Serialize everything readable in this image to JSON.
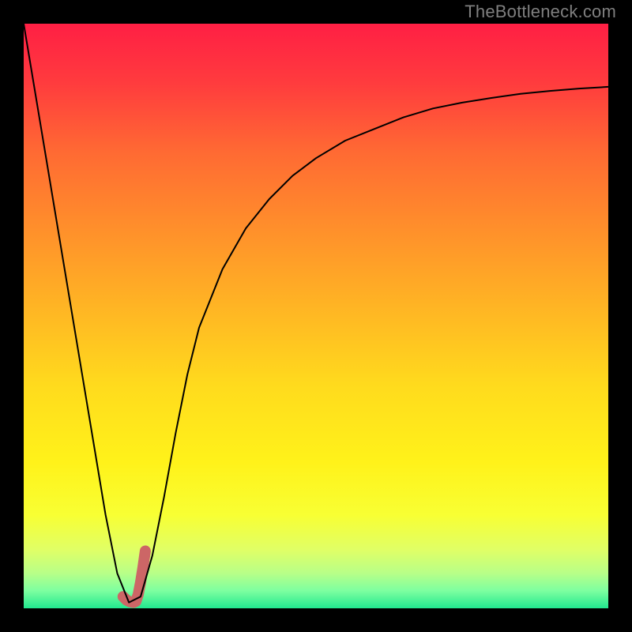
{
  "watermark": "TheBottleneck.com",
  "chart_data": {
    "type": "line",
    "title": "",
    "xlabel": "",
    "ylabel": "",
    "xlim": [
      0,
      100
    ],
    "ylim": [
      0,
      100
    ],
    "grid": false,
    "series": [
      {
        "name": "bottleneck-curve",
        "x": [
          0,
          2,
          4,
          6,
          8,
          10,
          12,
          14,
          16,
          18,
          20,
          22,
          24,
          26,
          28,
          30,
          34,
          38,
          42,
          46,
          50,
          55,
          60,
          65,
          70,
          75,
          80,
          85,
          90,
          95,
          100
        ],
        "y": [
          100,
          88,
          76,
          64,
          52,
          40,
          28,
          16,
          6,
          1,
          2,
          9,
          19,
          30,
          40,
          48,
          58,
          65,
          70,
          74,
          77,
          80,
          82,
          84,
          85.5,
          86.5,
          87.3,
          88,
          88.5,
          88.9,
          89.2
        ],
        "color": "#000000",
        "width": 2
      },
      {
        "name": "highlight-segment",
        "x": [
          17.0,
          17.6,
          18.2,
          18.8,
          19.2,
          19.6,
          20.0,
          20.4,
          20.8
        ],
        "y": [
          2.0,
          1.4,
          1.1,
          1.0,
          1.2,
          2.4,
          4.5,
          7.0,
          9.8
        ],
        "color": "#cc6666",
        "width": 14
      }
    ],
    "background_gradient": {
      "stops": [
        {
          "offset": 0.0,
          "color": "#ff1f44"
        },
        {
          "offset": 0.1,
          "color": "#ff3b3e"
        },
        {
          "offset": 0.22,
          "color": "#ff6a33"
        },
        {
          "offset": 0.35,
          "color": "#ff8f2b"
        },
        {
          "offset": 0.5,
          "color": "#ffb923"
        },
        {
          "offset": 0.62,
          "color": "#ffdb1d"
        },
        {
          "offset": 0.75,
          "color": "#fff21a"
        },
        {
          "offset": 0.84,
          "color": "#f8ff33"
        },
        {
          "offset": 0.9,
          "color": "#e0ff66"
        },
        {
          "offset": 0.94,
          "color": "#b8ff88"
        },
        {
          "offset": 0.97,
          "color": "#7dffa0"
        },
        {
          "offset": 1.0,
          "color": "#22e88f"
        }
      ]
    }
  }
}
